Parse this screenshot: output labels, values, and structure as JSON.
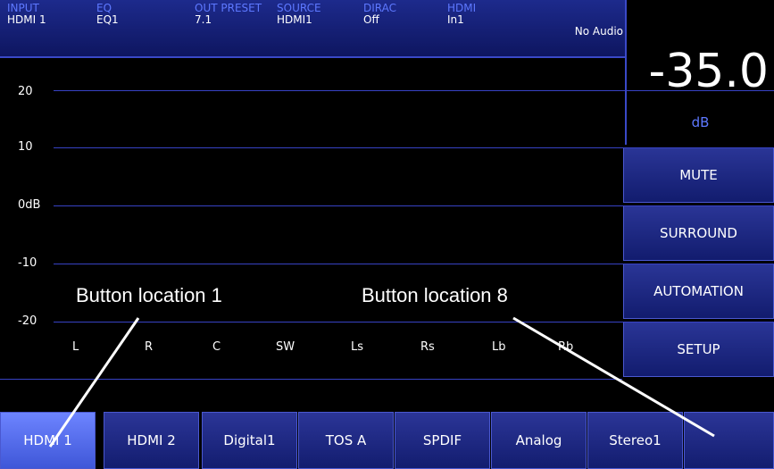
{
  "status": {
    "input_label": "INPUT",
    "input_value": "HDMI 1",
    "eq_label": "EQ",
    "eq_value": "EQ1",
    "out_label": "OUT PRESET",
    "out_value": "7.1",
    "source_label": "SOURCE",
    "source_value": "HDMI1",
    "dirac_label": "DIRAC",
    "dirac_value": "Off",
    "hdmi_label": "HDMI",
    "hdmi_value": "In1",
    "audio_status": "No Audio"
  },
  "volume": {
    "value": "-35.0",
    "unit": "dB"
  },
  "side_buttons": [
    "MUTE",
    "SURROUND",
    "AUTOMATION",
    "SETUP"
  ],
  "meter": {
    "scale": [
      "20",
      "10",
      "0dB",
      "-10",
      "-20"
    ],
    "channels": [
      "L",
      "R",
      "C",
      "SW",
      "Ls",
      "Rs",
      "Lb",
      "Rb"
    ]
  },
  "input_tabs": [
    "HDMI 1",
    "HDMI 2",
    "Digital1",
    "TOS A",
    "SPDIF",
    "Analog",
    "Stereo1",
    ""
  ],
  "active_tab": "HDMI 1",
  "annotations": [
    "Button location 1",
    "Button location 8"
  ]
}
